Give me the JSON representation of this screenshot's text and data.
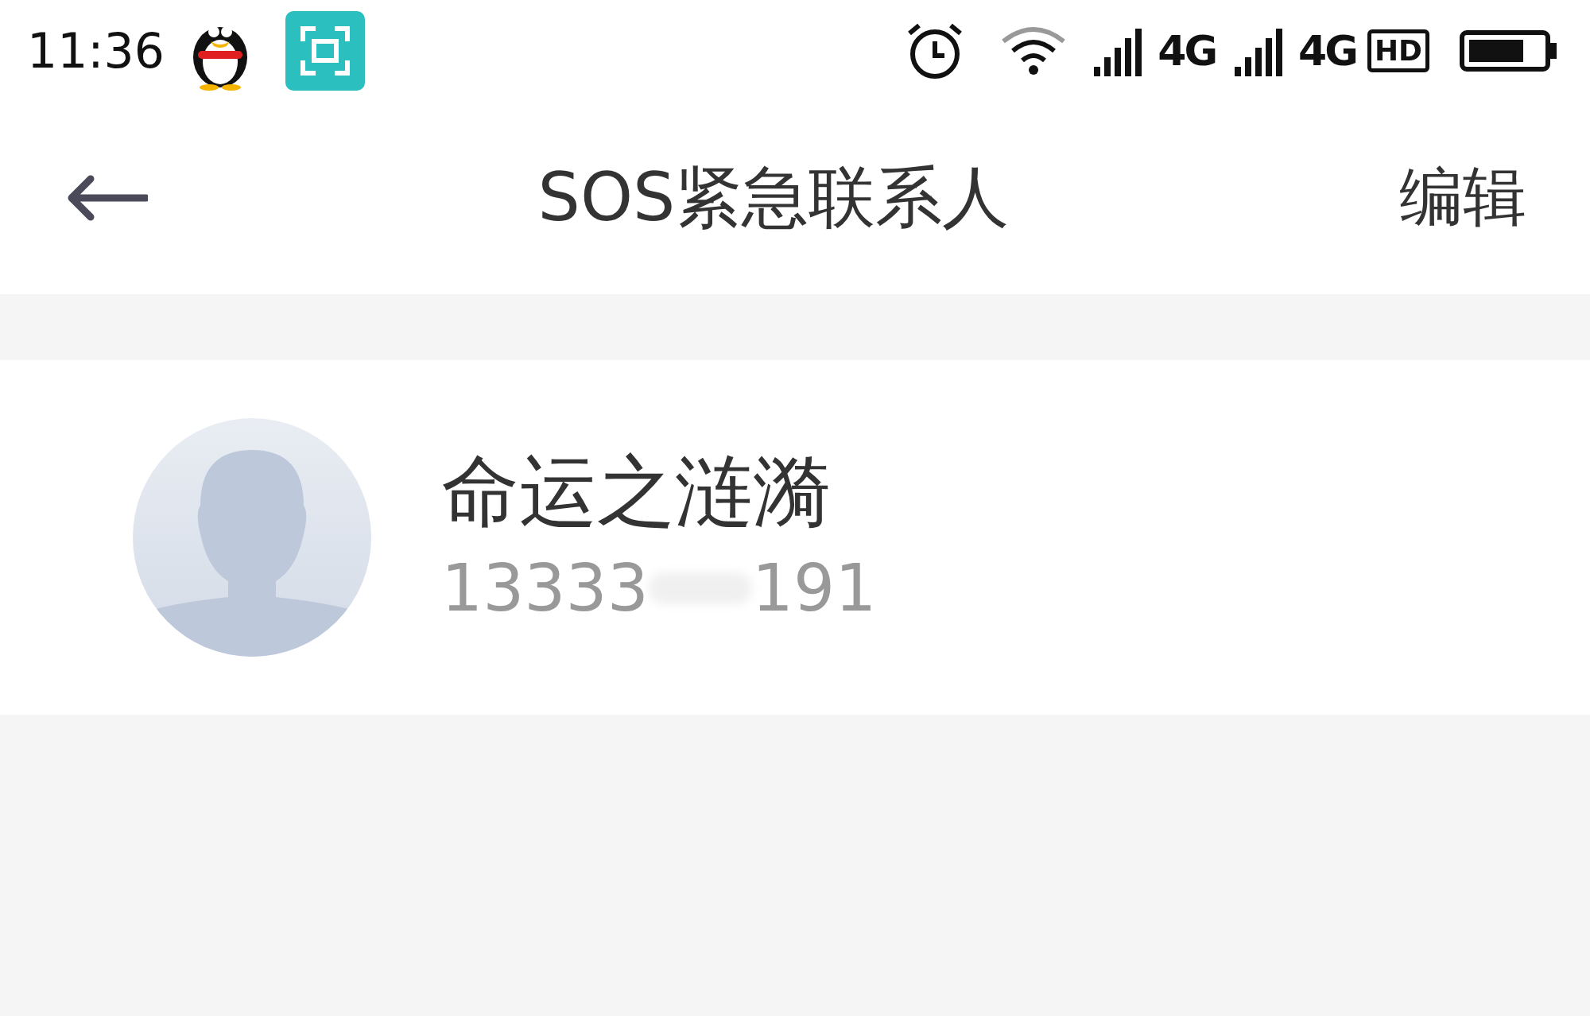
{
  "status_bar": {
    "time": "11:36",
    "network_1": "4G",
    "network_2": "4G",
    "hd_badge": "HD"
  },
  "header": {
    "title": "SOS紧急联系人",
    "action": "编辑"
  },
  "contacts": [
    {
      "name": "命运之涟漪",
      "phone_start": "13333",
      "phone_end": "191"
    }
  ]
}
